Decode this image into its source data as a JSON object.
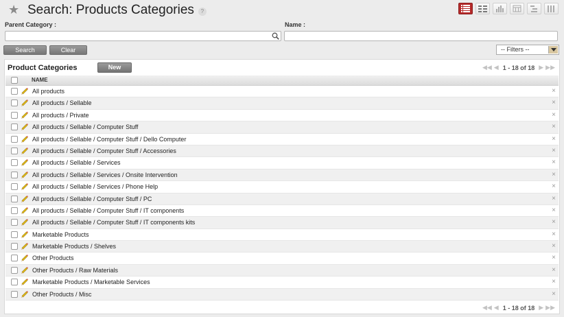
{
  "header": {
    "title": "Search: Products Categories",
    "help": "?"
  },
  "search": {
    "parent_label": "Parent Category :",
    "parent_value": "",
    "name_label": "Name :",
    "name_value": "",
    "search_button": "Search",
    "clear_button": "Clear",
    "filters_selected": "-- Filters --"
  },
  "list": {
    "title": "Product Categories",
    "new_button": "New",
    "pager_text": "1 - 18 of 18",
    "column_name": "NAME",
    "rows": [
      "All products",
      "All products / Sellable",
      "All products / Private",
      "All products / Sellable / Computer Stuff",
      "All products / Sellable / Computer Stuff / Dello Computer",
      "All products / Sellable / Computer Stuff / Accessories",
      "All products / Sellable / Services",
      "All products / Sellable / Services / Onsite Intervention",
      "All products / Sellable / Services / Phone Help",
      "All products / Sellable / Computer Stuff / PC",
      "All products / Sellable / Computer Stuff / IT components",
      "All products / Sellable / Computer Stuff / IT components kits",
      "Marketable Products",
      "Marketable Products / Shelves",
      "Other Products",
      "Other Products / Raw Materials",
      "Marketable Products / Marketable Services",
      "Other Products / Misc"
    ],
    "delete_glyph": "×"
  },
  "icons": {
    "star": "star-icon",
    "views": [
      "list-view-icon",
      "form-view-icon",
      "graph-view-icon",
      "calendar-view-icon",
      "gantt-view-icon",
      "diagram-view-icon"
    ],
    "pager": [
      "first-page-icon",
      "prev-page-icon",
      "next-page-icon",
      "last-page-icon"
    ]
  },
  "colors": {
    "accent": "#b52a2a",
    "button": "#858585",
    "row_alt": "#f0f0f0"
  }
}
